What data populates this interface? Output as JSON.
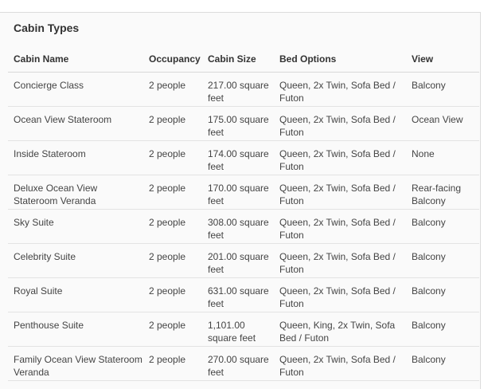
{
  "section": {
    "title": "Cabin Types"
  },
  "table": {
    "headers": [
      "Cabin Name",
      "Occupancy",
      "Cabin Size",
      "Bed Options",
      "View"
    ],
    "rows": [
      [
        "Concierge Class",
        "2 people",
        "217.00 square feet",
        "Queen, 2x Twin, Sofa Bed / Futon",
        "Balcony"
      ],
      [
        "Ocean View Stateroom",
        "2 people",
        "175.00 square feet",
        "Queen, 2x Twin, Sofa Bed / Futon",
        "Ocean View"
      ],
      [
        "Inside Stateroom",
        "2 people",
        "174.00 square feet",
        "Queen, 2x Twin, Sofa Bed / Futon",
        "None"
      ],
      [
        "Deluxe Ocean View Stateroom Veranda",
        "2 people",
        "170.00 square feet",
        "Queen, 2x Twin, Sofa Bed / Futon",
        "Rear-facing Balcony"
      ],
      [
        "Sky Suite",
        "2 people",
        "308.00 square feet",
        "Queen, 2x Twin, Sofa Bed / Futon",
        "Balcony"
      ],
      [
        "Celebrity Suite",
        "2 people",
        "201.00 square feet",
        "Queen, 2x Twin, Sofa Bed / Futon",
        "Balcony"
      ],
      [
        "Royal Suite",
        "2 people",
        "631.00 square feet",
        "Queen, 2x Twin, Sofa Bed / Futon",
        "Balcony"
      ],
      [
        "Penthouse Suite",
        "2 people",
        "1,101.00 square feet",
        "Queen, King, 2x Twin, Sofa Bed / Futon",
        "Balcony"
      ],
      [
        "Family Ocean View Stateroom Veranda",
        "2 people",
        "270.00 square feet",
        "Queen, 2x Twin, Sofa Bed / Futon",
        "Balcony"
      ]
    ]
  }
}
